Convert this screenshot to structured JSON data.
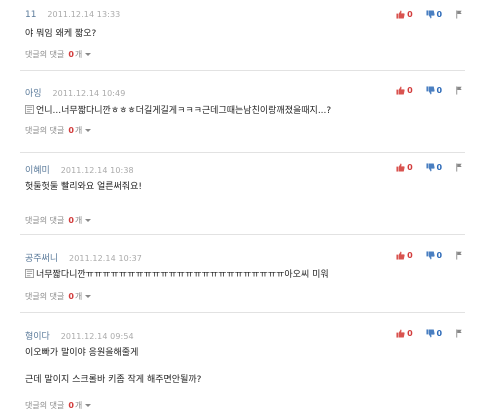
{
  "reply_label": "댓글의 댓글",
  "reply_unit": "개",
  "comments": [
    {
      "author": "11",
      "date": "2011.12.14 13:33",
      "like": "0",
      "dislike": "0",
      "lines": [
        "야 뭐임 왜케 짧오?"
      ],
      "reply_count": "0"
    },
    {
      "author": "아잉",
      "date": "2011.12.14 10:49",
      "like": "0",
      "dislike": "0",
      "lines": [
        "언니...너무짧다니깐ㅎㅎㅎ더길게길게ㅋㅋㅋ근데그때는남친이랑깨졌을때지...?"
      ],
      "reply_count": "0",
      "has_image_icon": true
    },
    {
      "author": "이혜미",
      "date": "2011.12.14 10:38",
      "like": "0",
      "dislike": "0",
      "lines": [
        "헛둘헛둘  빨리와요 얼른써줘요!"
      ],
      "reply_count": "0"
    },
    {
      "author": "공주써니",
      "date": "2011.12.14 10:37",
      "like": "0",
      "dislike": "0",
      "lines": [
        "너무짧다니깐ㅠㅠㅠㅠㅠㅠㅠㅠㅠㅠㅠㅠㅠㅠㅠㅠㅠㅠㅠㅠㅠㅠㅠㅠ아오씨 미워"
      ],
      "reply_count": "0",
      "has_image_icon": true
    },
    {
      "author": "형이다",
      "date": "2011.12.14 09:54",
      "like": "0",
      "dislike": "0",
      "lines": [
        "이오빠가 말이야 응원을해줄게",
        "근데 말이지 스크롤바 키좀 작게 해주면안될까?"
      ],
      "reply_count": "0"
    }
  ]
}
